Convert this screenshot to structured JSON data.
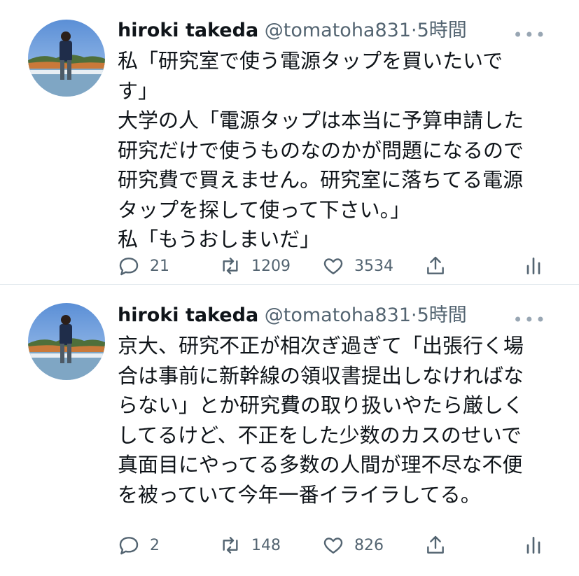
{
  "tweets": [
    {
      "name": "hiroki takeda",
      "handle": "@tomatoha831",
      "dot": "·",
      "time": "5時間",
      "more": "•••",
      "text": "私「研究室で使う電源タップを買いたいで\nす」\n大学の人「電源タップは本当に予算申請した\n研究だけで使うものなのかが問題になるので\n研究費で買えません。研究室に落ちてる電源\nタップを探して使って下さい。」\n私「もうおしまいだ」",
      "replies": "21",
      "retweets": "1209",
      "likes": "3534"
    },
    {
      "name": "hiroki takeda",
      "handle": "@tomatoha831",
      "dot": "·",
      "time": "5時間",
      "more": "•••",
      "text": "京大、研究不正が相次ぎ過ぎて「出張行く場\n合は事前に新幹線の領収書提出しなければな\nらない」とか研究費の取り扱いやたら厳しく\nしてるけど、不正をした少数のカスのせいで\n真面目にやってる多数の人間が理不尽な不便\nを被っていて今年一番イライラしてる。",
      "replies": "2",
      "retweets": "148",
      "likes": "826"
    }
  ],
  "icons": [
    "reply-icon",
    "retweet-icon",
    "like-icon",
    "share-icon",
    "analytics-icon"
  ],
  "colors": {
    "text": "#0f1419",
    "muted": "#536471",
    "divider": "#e6ecf0"
  }
}
